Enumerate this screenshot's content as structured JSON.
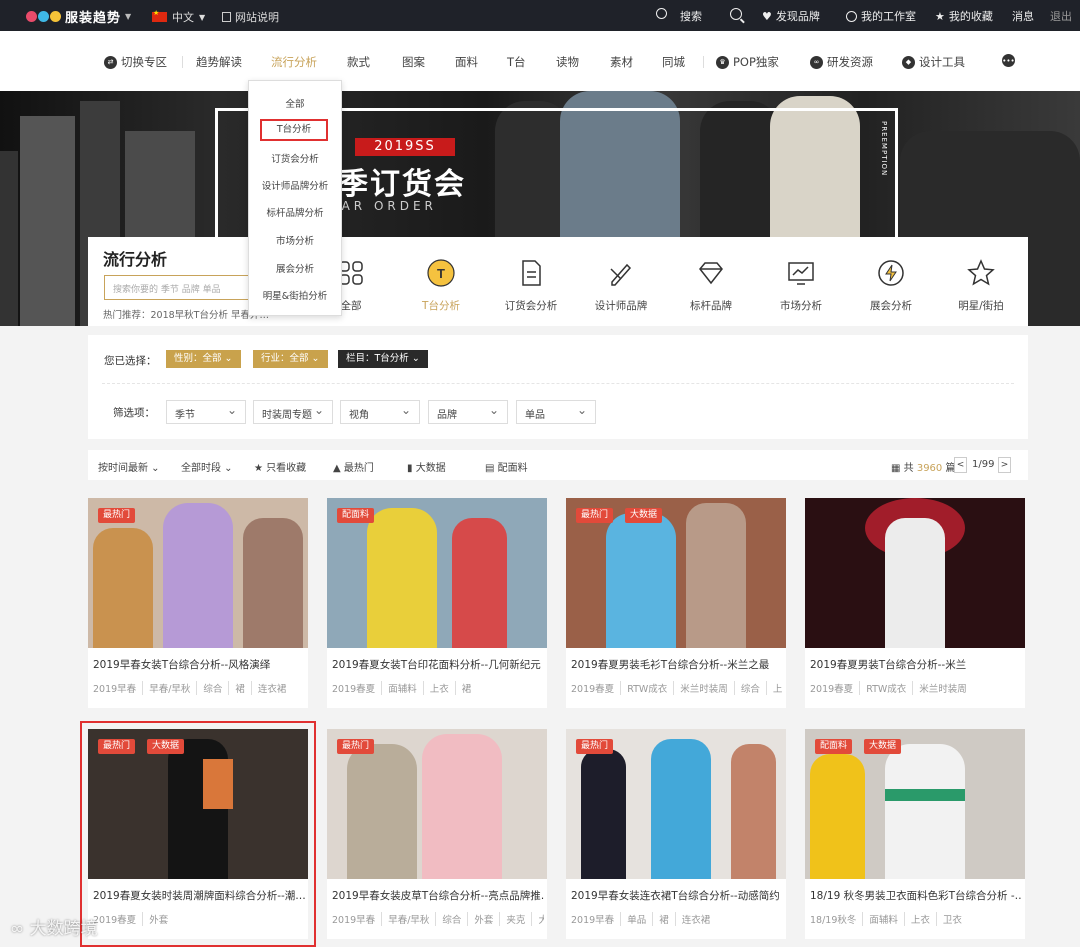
{
  "topbar": {
    "brand": "服装趋势",
    "language": "中文",
    "help": "网站说明",
    "search_label": "搜索",
    "discover": "发现品牌",
    "workspace": "我的工作室",
    "favorites": "我的收藏",
    "messages": "消息",
    "logout": "退出"
  },
  "nav": {
    "items": [
      "切换专区",
      "趋势解读",
      "流行分析",
      "款式",
      "图案",
      "面料",
      "T台",
      "读物",
      "素材",
      "同城",
      "POP独家",
      "研发资源",
      "设计工具"
    ]
  },
  "dropdown": {
    "items": [
      "全部",
      "T台分析",
      "订货会分析",
      "设计师品牌分析",
      "标杆品牌分析",
      "市场分析",
      "展会分析",
      "明星&街拍分析"
    ]
  },
  "banner": {
    "season": "2019SS",
    "title_cn": "季订货会",
    "title_en": "EAR ORDER",
    "side_text": "PREEMPTION"
  },
  "panel": {
    "title": "流行分析",
    "search_placeholder": "搜索你要的 季节 品牌 单品",
    "hot_search": "热门推荐：2018早秋T台分析  早春外…",
    "categories": [
      "全部",
      "T台分析",
      "订货会分析",
      "设计师品牌",
      "标杆品牌",
      "市场分析",
      "展会分析",
      "明星/街拍"
    ]
  },
  "filters": {
    "selected_label": "您已选择：",
    "chips": [
      "性别：全部",
      "行业：全部",
      "栏目：T台分析"
    ],
    "filter_label": "筛选项：",
    "selects": [
      "季节",
      "时装周专题",
      "视角",
      "品牌",
      "单品"
    ]
  },
  "sortbar": {
    "sort": "按时间最新",
    "period": "全部时段",
    "only_fav": "只看收藏",
    "hottest": "最热门",
    "bigdata": "大数据",
    "fabric": "配面料",
    "total_prefix": "共",
    "total": "3960",
    "total_suffix": "篇",
    "page": "1/99",
    "prev": "<",
    "next": ">"
  },
  "cards": [
    {
      "title": "2019早春女装T台综合分析--风格演绎",
      "tags": [
        "2019早春",
        "早春/早秋",
        "综合",
        "裙",
        "连衣裙"
      ],
      "badges": [
        "最热门"
      ]
    },
    {
      "title": "2019春夏女装T台印花面料分析--几何新纪元",
      "tags": [
        "2019春夏",
        "面辅料",
        "上衣",
        "裙"
      ],
      "badges": [
        "配面料"
      ]
    },
    {
      "title": "2019春夏男装毛衫T台综合分析--米兰之最",
      "tags": [
        "2019春夏",
        "RTW成衣",
        "米兰时装周",
        "综合",
        "上"
      ],
      "badges": [
        "最热门",
        "大数据"
      ]
    },
    {
      "title": "2019春夏男装T台综合分析--米兰",
      "tags": [
        "2019春夏",
        "RTW成衣",
        "米兰时装周"
      ],
      "badges": []
    },
    {
      "title": "2019春夏女装时装周潮牌面料综合分析--潮…",
      "tags": [
        "2019春夏",
        "外套"
      ],
      "badges": [
        "最热门",
        "大数据"
      ]
    },
    {
      "title": "2019早春女装皮草T台综合分析--亮点品牌推…",
      "tags": [
        "2019早春",
        "早春/早秋",
        "综合",
        "外套",
        "夹克",
        "大"
      ],
      "badges": [
        "最热门"
      ]
    },
    {
      "title": "2019早春女装连衣裙T台综合分析--动感简约",
      "tags": [
        "2019早春",
        "单品",
        "裙",
        "连衣裙"
      ],
      "badges": [
        "最热门"
      ]
    },
    {
      "title": "18/19 秋冬男装卫衣面料色彩T台综合分析 -…",
      "tags": [
        "18/19秋冬",
        "面辅料",
        "上衣",
        "卫衣"
      ],
      "badges": [
        "配面料",
        "大数据"
      ]
    }
  ],
  "watermark": "大数跨境"
}
